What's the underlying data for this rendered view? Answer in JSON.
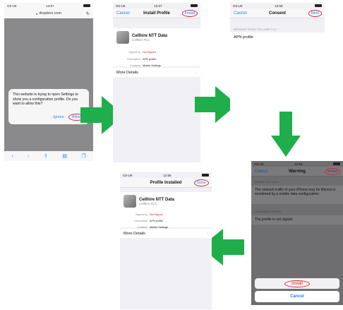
{
  "p1": {
    "carrier": "O2-UK",
    "time": "12:57",
    "url": "dropbox.com",
    "alert": "This website is trying to open Settings to show you a configuration profile. Do you want to allow this?",
    "ignore": "Ignore",
    "allow": "Allow"
  },
  "p2": {
    "carrier": "O2-UK",
    "time": "12:57",
    "cancel": "Cancel",
    "title": "Install Profile",
    "install": "Install",
    "profile_name": "Cellhire NTT Data",
    "profile_org": "Cellhire PLC",
    "signed_k": "Signed by",
    "signed_v": "Not Signed",
    "desc_k": "Description",
    "desc_v": "APN profile",
    "contains_k": "Contains",
    "contains_v": "Mobile Settings",
    "more": "More Details"
  },
  "p3": {
    "carrier": "O2-UK",
    "time": "12:58",
    "cancel": "Cancel",
    "title": "Consent",
    "next": "Next",
    "header": "MESSAGE FROM \"CELLHIRE PLC\"",
    "body": "APN profile"
  },
  "p4": {
    "carrier": "O2-UK",
    "time": "12:58",
    "cancel": "Cancel",
    "title": "Warning",
    "install": "Install",
    "sec1": "MOBILE SETTINGS",
    "text1": "The network traffic of your iPhone may be filtered or monitored by a mobile data configuration.",
    "sec2": "UNSIGNED PROFILE",
    "text2": "The profile is not signed.",
    "sheet_install": "Install",
    "sheet_cancel": "Cancel"
  },
  "p5": {
    "carrier": "O2-UK",
    "time": "12:58",
    "title": "Profile Installed",
    "done": "Done",
    "profile_name": "Cellhire NTT Data",
    "profile_org": "Cellhire PLC",
    "signed_k": "Signed by",
    "signed_v": "Not Signed",
    "desc_k": "Description",
    "desc_v": "APN profile",
    "contains_k": "Contains",
    "contains_v": "Mobile Settings",
    "more": "More Details"
  },
  "colors": {
    "accent": "#2f7cf6",
    "arrow": "#1fae4b",
    "annotation": "#e8202a"
  }
}
